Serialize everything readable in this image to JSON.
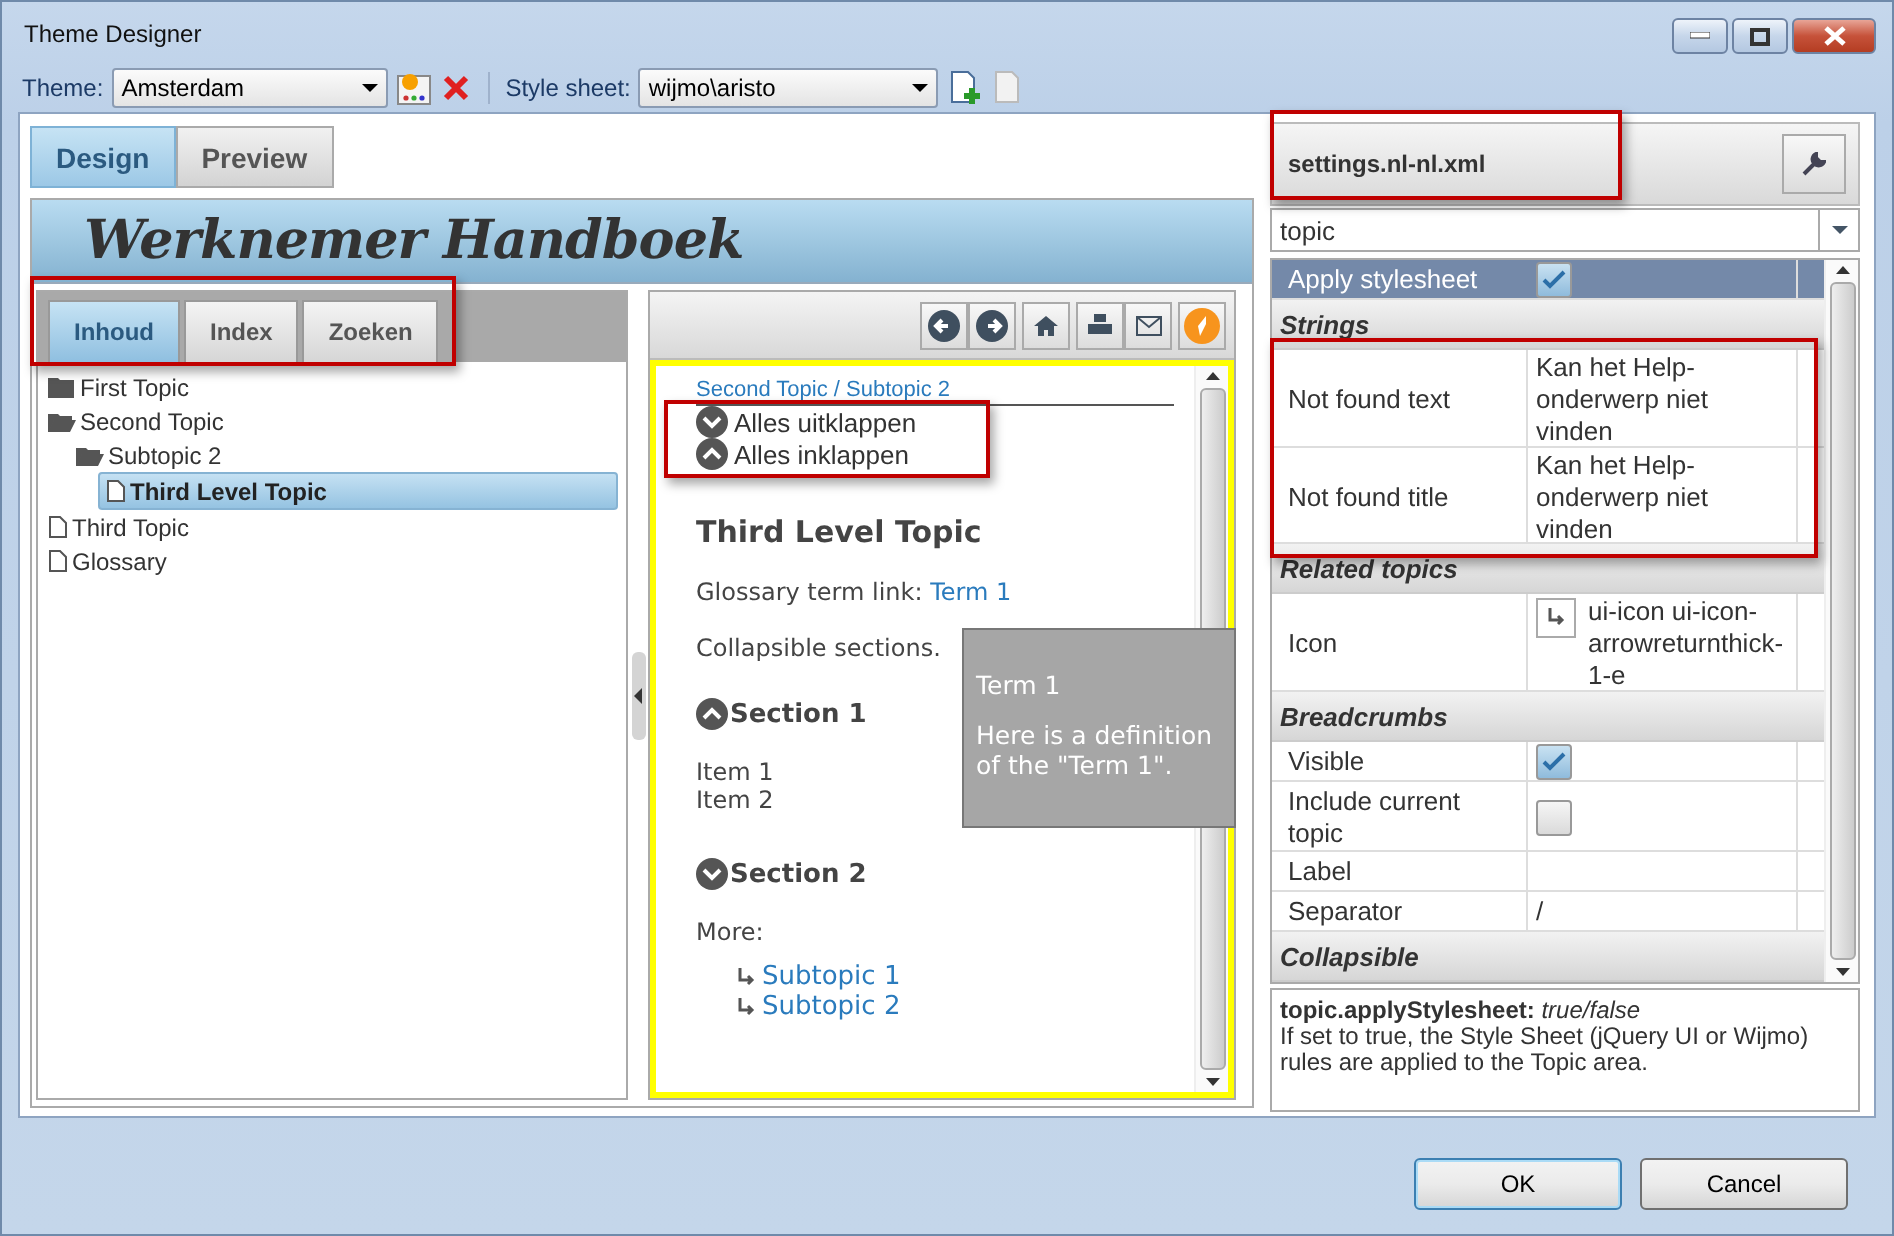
{
  "window": {
    "title": "Theme Designer"
  },
  "toolbar": {
    "theme_label": "Theme:",
    "theme_value": "Amsterdam",
    "stylesheet_label": "Style sheet:",
    "stylesheet_value": "wijmo\\aristo"
  },
  "view_tabs": [
    {
      "label": "Design",
      "selected": true
    },
    {
      "label": "Preview",
      "selected": false
    }
  ],
  "banner_title": "Werknemer Handboek",
  "nav_tabs": [
    {
      "label": "Inhoud",
      "selected": true
    },
    {
      "label": "Index",
      "selected": false
    },
    {
      "label": "Zoeken",
      "selected": false
    }
  ],
  "tree": [
    {
      "label": "First Topic",
      "kind": "folder",
      "expanded": false,
      "selected": false
    },
    {
      "label": "Second Topic",
      "kind": "folder",
      "expanded": true,
      "selected": false,
      "children": [
        {
          "label": "Subtopic 2",
          "kind": "folder",
          "expanded": true,
          "selected": false,
          "children": [
            {
              "label": "Third Level Topic",
              "kind": "page",
              "selected": true
            }
          ]
        }
      ]
    },
    {
      "label": "Third Topic",
      "kind": "page",
      "selected": false
    },
    {
      "label": "Glossary",
      "kind": "page",
      "selected": false
    }
  ],
  "content": {
    "breadcrumb": "Second Topic / Subtopic 2",
    "expand_all": "Alles uitklappen",
    "collapse_all": "Alles inklappen",
    "heading": "Third Level Topic",
    "glossary_label": "Glossary term link:",
    "glossary_link": "Term 1",
    "collapsible_text": "Collapsible sections.",
    "sections": [
      {
        "title": "Section 1",
        "expanded": true,
        "items": [
          "Item 1",
          "Item 2"
        ]
      },
      {
        "title": "Section 2",
        "expanded": false
      }
    ],
    "more_label": "More:",
    "more_links": [
      "Subtopic 1",
      "Subtopic 2"
    ]
  },
  "tooltip": {
    "title": "Term 1",
    "text": "Here is a definition of the \"Term 1\"."
  },
  "settings": {
    "file": "settings.nl-nl.xml",
    "filter": "topic",
    "rows": [
      {
        "kind": "checkbox",
        "label": "Apply stylesheet",
        "checked": true,
        "selected": true
      },
      {
        "kind": "group",
        "label": "Strings"
      },
      {
        "kind": "text",
        "label": "Not found text",
        "value": "Kan het Help-onderwerp niet vinden",
        "selected": false
      },
      {
        "kind": "text",
        "label": "Not found title",
        "value": "Kan het Help-onderwerp niet vinden",
        "selected": false
      },
      {
        "kind": "group",
        "label": "Related topics"
      },
      {
        "kind": "icon",
        "label": "Icon",
        "value": "ui-icon ui-icon-arrowreturnthick-1-e",
        "selected": false
      },
      {
        "kind": "group",
        "label": "Breadcrumbs"
      },
      {
        "kind": "checkbox",
        "label": "Visible",
        "checked": true,
        "selected": false
      },
      {
        "kind": "checkbox",
        "label": "Include current topic",
        "checked": false,
        "selected": false
      },
      {
        "kind": "text",
        "label": "Label",
        "selected": false
      },
      {
        "kind": "text",
        "label": "Separator",
        "value": "/",
        "selected": false
      },
      {
        "kind": "group",
        "label": "Collapsible"
      }
    ],
    "description": {
      "key": "topic.applyStylesheet:",
      "type": "true/false",
      "text": "If set to true, the Style Sheet (jQuery UI or Wijmo) rules are applied to the Topic area."
    }
  },
  "buttons": [
    "OK",
    "Cancel"
  ]
}
